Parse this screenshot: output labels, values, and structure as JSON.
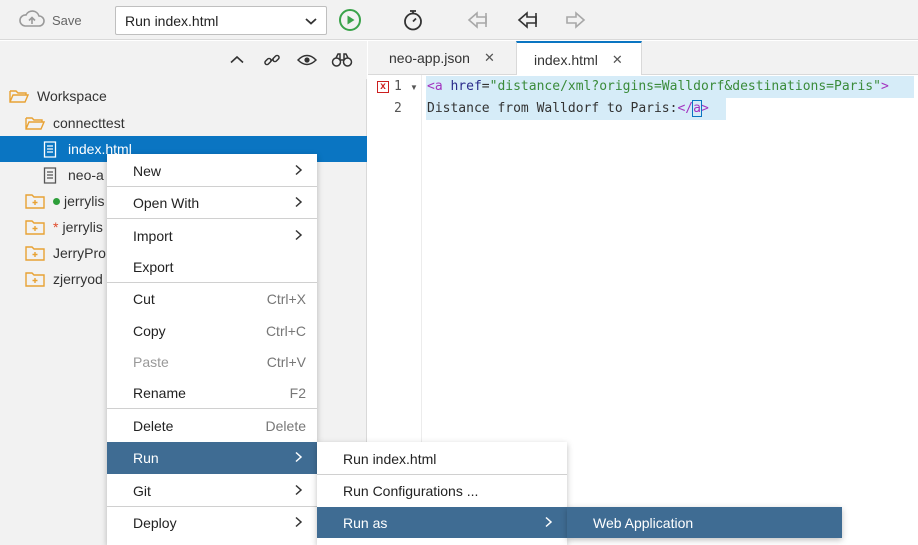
{
  "toolbar": {
    "save_label": "Save",
    "run_config": "Run index.html"
  },
  "tree": {
    "items": [
      {
        "label": "Workspace"
      },
      {
        "label": "connecttest"
      },
      {
        "label": "index.html"
      },
      {
        "label": "neo-a"
      },
      {
        "label": "jerrylis"
      },
      {
        "label": "jerrylis"
      },
      {
        "label": "JerryPro"
      },
      {
        "label": "zjerryod"
      }
    ],
    "modified_marker": "*"
  },
  "tabs": [
    {
      "label": "neo-app.json",
      "close": "✕"
    },
    {
      "label": "index.html",
      "close": "✕"
    }
  ],
  "editor": {
    "line_numbers": [
      "1",
      "2"
    ],
    "error_marker": "x",
    "line1": {
      "open": "<a",
      "attr": " href",
      "eq": "=",
      "value": "\"distance/xml?origins=Walldorf&destinations=Paris\"",
      "close": ">"
    },
    "line2": {
      "text": "Distance from Walldorf to Paris:",
      "end_open": "</",
      "end_name": "a",
      "end_close": ">"
    }
  },
  "context_menu": {
    "items": [
      {
        "label": "New",
        "shortcut": ""
      },
      {
        "label": "Open With",
        "shortcut": ""
      },
      {
        "label": "Import",
        "shortcut": ""
      },
      {
        "label": "Export",
        "shortcut": ""
      },
      {
        "label": "Cut",
        "shortcut": "Ctrl+X"
      },
      {
        "label": "Copy",
        "shortcut": "Ctrl+C"
      },
      {
        "label": "Paste",
        "shortcut": "Ctrl+V"
      },
      {
        "label": "Rename",
        "shortcut": "F2"
      },
      {
        "label": "Delete",
        "shortcut": "Delete"
      },
      {
        "label": "Run",
        "shortcut": ""
      },
      {
        "label": "Git",
        "shortcut": ""
      },
      {
        "label": "Deploy",
        "shortcut": ""
      }
    ]
  },
  "run_submenu": {
    "items": [
      {
        "label": "Run index.html"
      },
      {
        "label": "Run Configurations ..."
      },
      {
        "label": "Run as"
      }
    ]
  },
  "runas_submenu": {
    "items": [
      {
        "label": "Web Application"
      }
    ]
  },
  "colors": {
    "selection": "#0a75c2",
    "menu_highlight": "#3f6c93",
    "run_icon": "#3aa34a"
  }
}
